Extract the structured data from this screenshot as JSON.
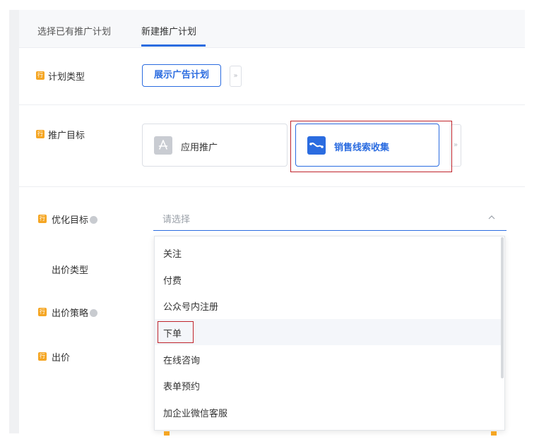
{
  "tabs": {
    "existing": "选择已有推广计划",
    "new": "新建推广计划"
  },
  "badge_text": "行",
  "rows": {
    "plan_type": {
      "label": "计划类型",
      "button": "展示广告计划",
      "more": "»"
    },
    "goal": {
      "label": "推广目标",
      "cards": [
        {
          "label": "应用推广"
        },
        {
          "label": "销售线索收集"
        }
      ],
      "more": "»"
    },
    "optimize": {
      "label": "优化目标",
      "placeholder": "请选择"
    },
    "bid_type": {
      "label": "出价类型"
    },
    "bid_strategy": {
      "label": "出价策略"
    },
    "bid": {
      "label": "出价"
    }
  },
  "dropdown": {
    "options": [
      "关注",
      "付费",
      "公众号内注册",
      "下单",
      "在线咨询",
      "表单预约",
      "加企业微信客服"
    ]
  },
  "colors": {
    "accent": "#2b6ce0",
    "badge": "#f5a623",
    "highlight": "#c0242b"
  }
}
